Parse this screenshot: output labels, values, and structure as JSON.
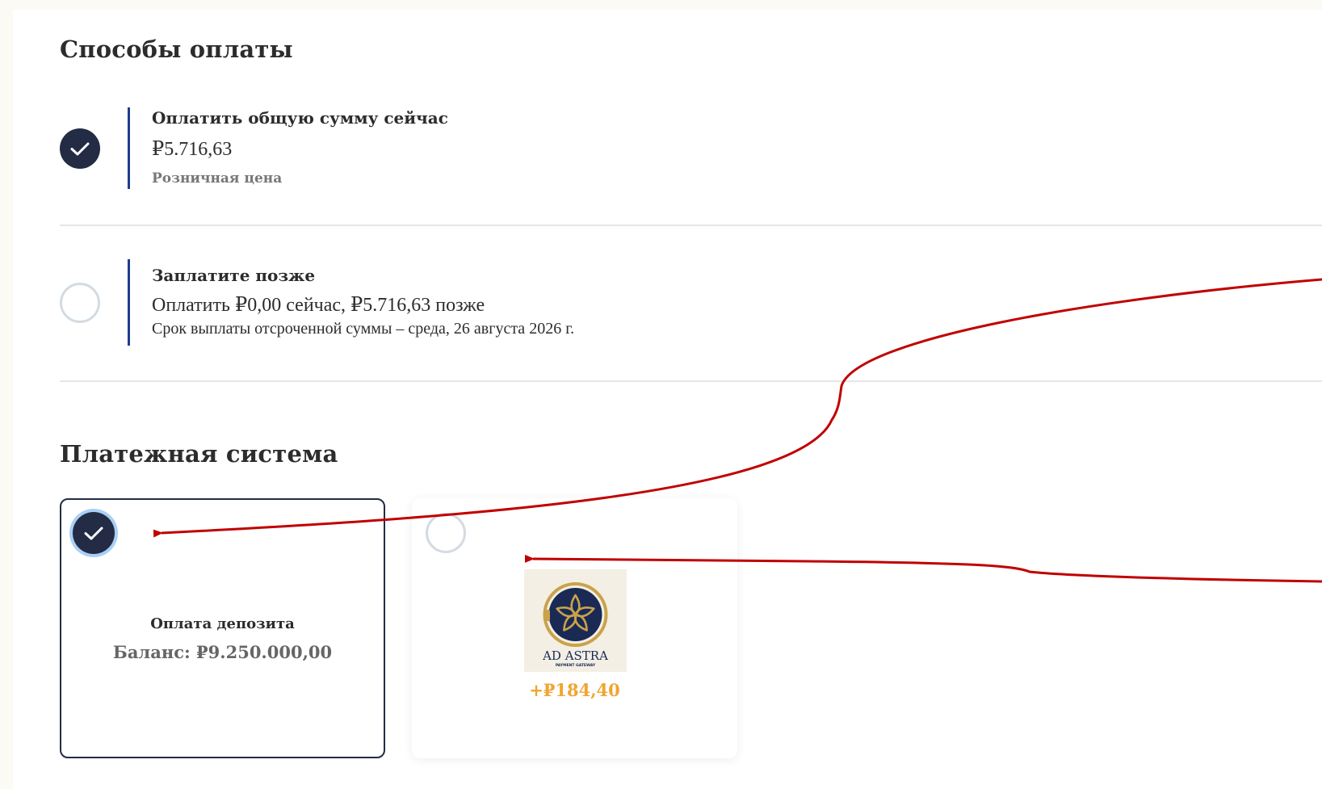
{
  "payment_methods": {
    "title": "Способы оплаты",
    "options": [
      {
        "title": "Оплатить общую сумму сейчас",
        "amount": "₽5.716,63",
        "note": "Розничная цена",
        "selected": true
      },
      {
        "title": "Заплатите позже",
        "amount": "Оплатить ₽0,00 сейчас, ₽5.716,63 позже",
        "note": "Срок выплаты отсроченной суммы – среда, 26 августа 2026 г.",
        "selected": false
      }
    ]
  },
  "payment_system": {
    "title": "Платежная система",
    "gateways": [
      {
        "name": "Оплата депозита",
        "balance": "Баланс: ₽9.250.000,00",
        "selected": true
      },
      {
        "logo_text": "AD ASTRA",
        "logo_subtext": "PAYMENT GATEWAY",
        "fee": "+₽184,40",
        "selected": false
      }
    ]
  },
  "colors": {
    "selected_radio": "#232c44",
    "option_bar": "#1d3e8f",
    "fee": "#f0a531",
    "annotation_arrow": "#c00000",
    "logo_gold": "#c9a24a",
    "logo_navy": "#1a2a55"
  },
  "icons": {
    "selected_radio": "check-icon",
    "logo": "ad-astra-star-logo"
  }
}
